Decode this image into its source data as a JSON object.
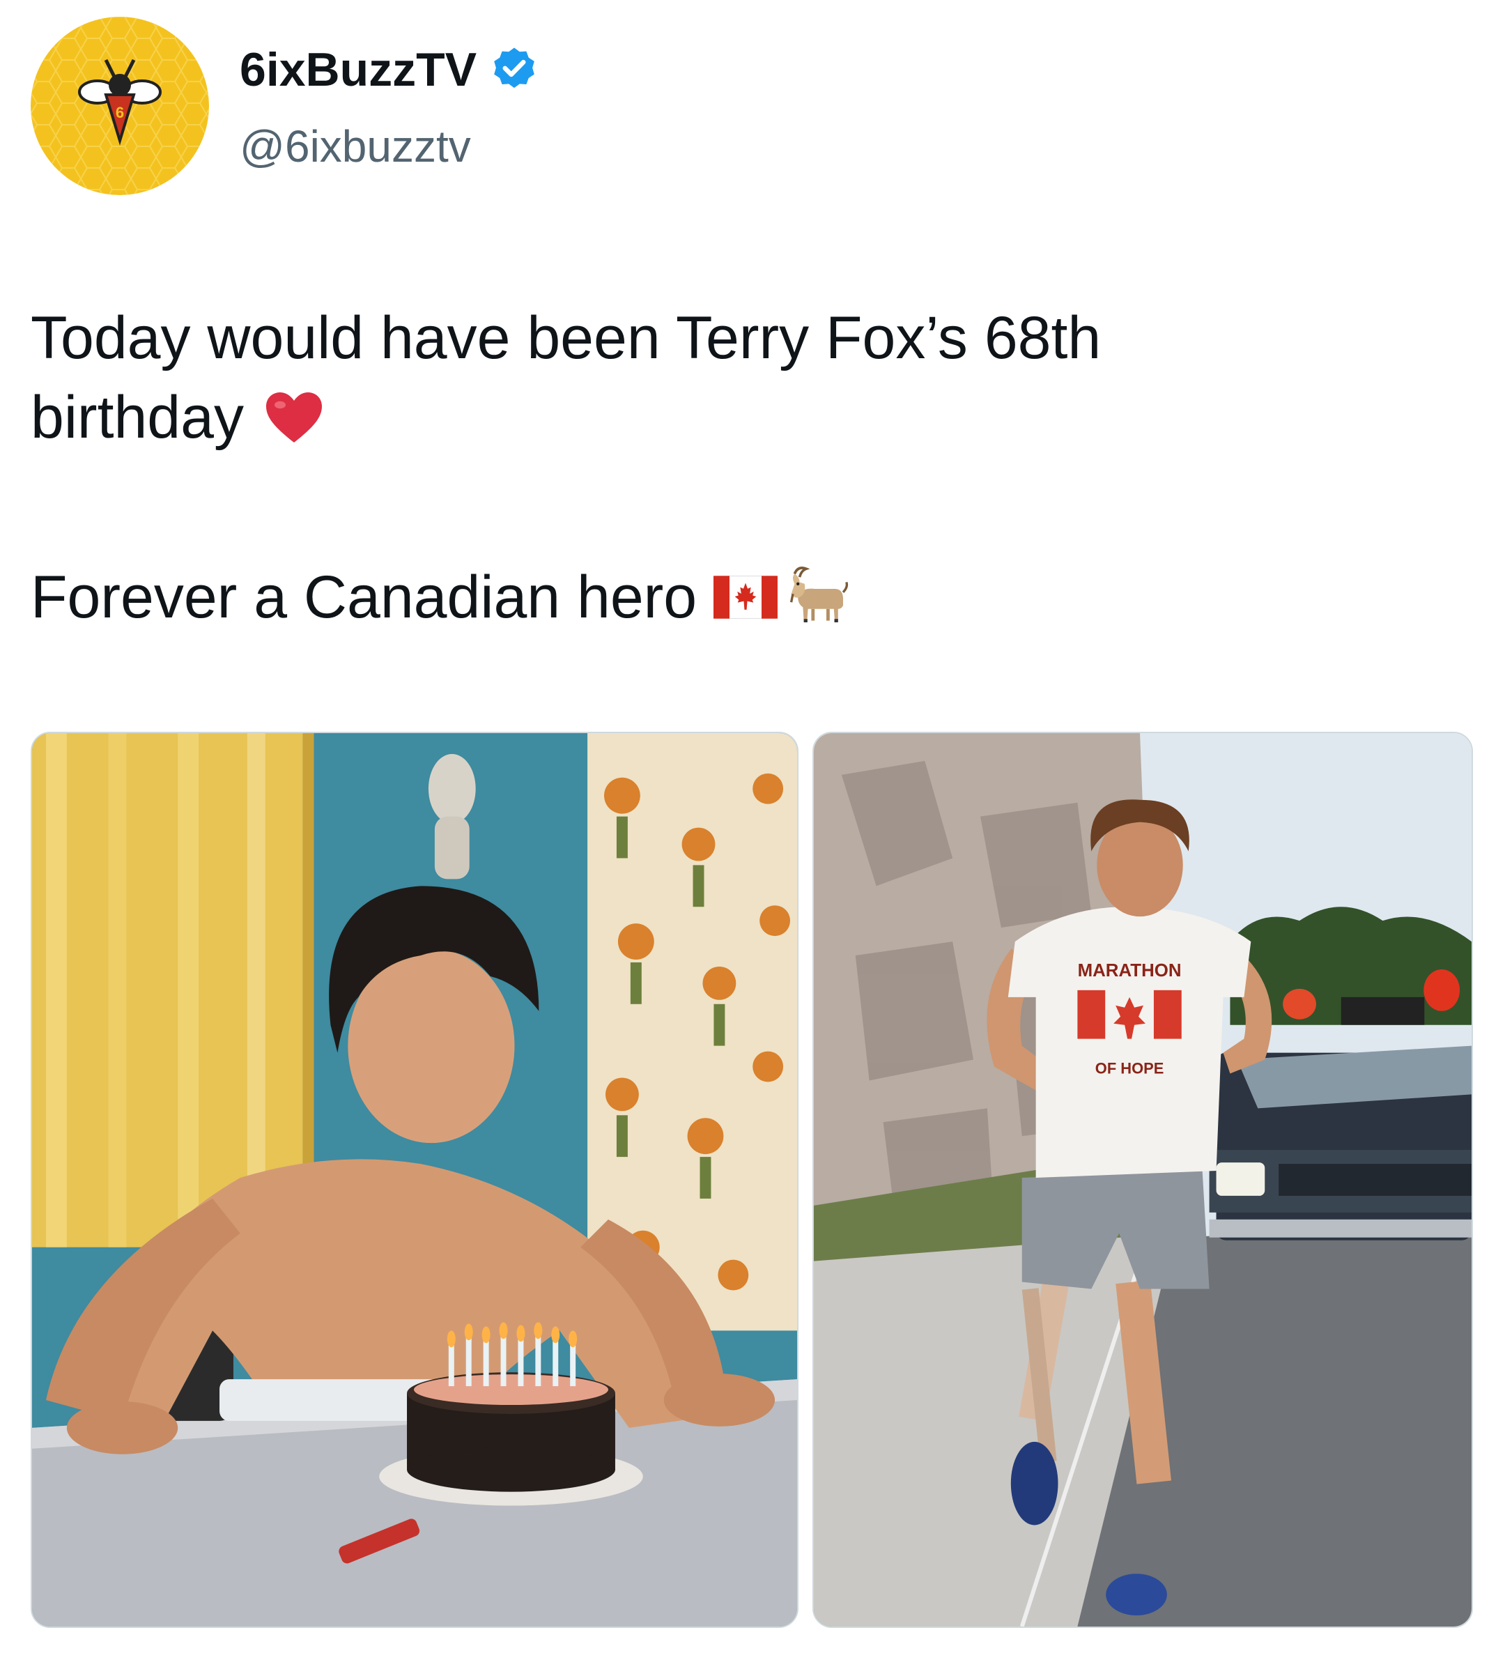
{
  "author": {
    "display_name": "6ixBuzzTV",
    "handle": "@6ixbuzztv",
    "verified": true,
    "avatar_icon": "bee-logo-icon",
    "verified_icon": "verified-badge-icon",
    "accent_color": "#1d9bf0"
  },
  "tweet": {
    "line1": "Today would have been Terry Fox’s 68th",
    "line2": "birthday",
    "line2_emoji": "red-heart-icon",
    "line3": "Forever a Canadian hero",
    "line3_emojis": [
      "canada-flag-icon",
      "goat-icon"
    ]
  },
  "media": [
    {
      "name": "birthday-cake-photo",
      "shirt_text_top": "",
      "shirt_text_bottom": ""
    },
    {
      "name": "marathon-of-hope-photo",
      "shirt_text_top": "MARATHON",
      "shirt_text_bottom": "OF HOPE"
    }
  ]
}
